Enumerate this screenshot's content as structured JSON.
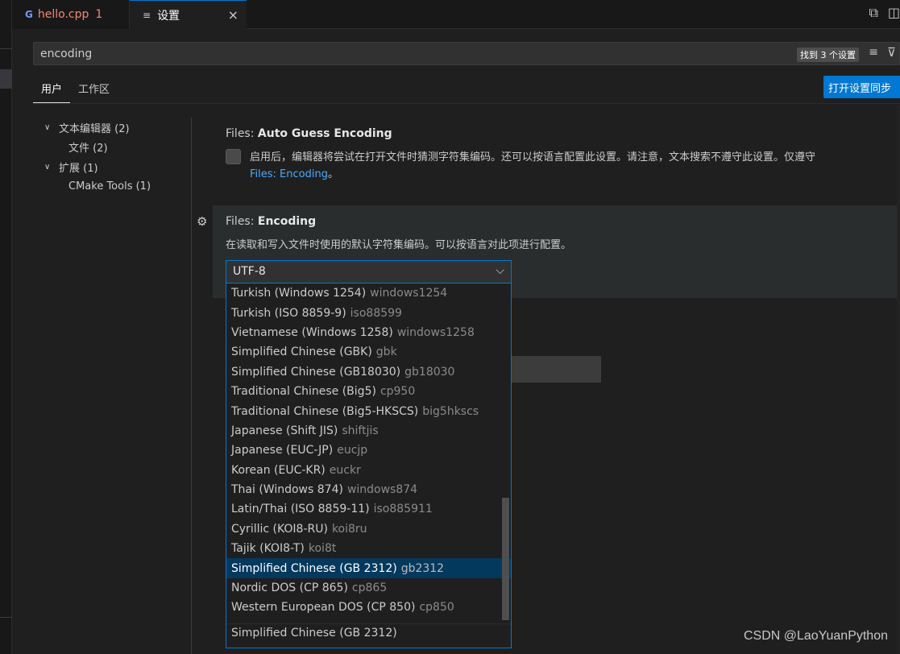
{
  "tabs": {
    "file": {
      "name": "hello.cpp",
      "problems": "1",
      "icon": "G"
    },
    "settings": {
      "icon": "≡",
      "name": "设置",
      "close": "×"
    }
  },
  "top_actions": [
    "⧉",
    "◫"
  ],
  "search": {
    "value": "encoding",
    "result_count": "找到 3 个设置",
    "filter_list_icon": "≡",
    "filter_icon": "⊽"
  },
  "scopes": {
    "user": "用户",
    "workspace": "工作区"
  },
  "sync_button": "打开设置同步",
  "toc": [
    {
      "chev": "∨",
      "label": "文本编辑器 (2)",
      "indent": false
    },
    {
      "chev": "",
      "label": "文件 (2)",
      "indent": true
    },
    {
      "chev": "∨",
      "label": "扩展 (1)",
      "indent": false
    },
    {
      "chev": "",
      "label": "CMake Tools (1)",
      "indent": true
    }
  ],
  "setting_auto_guess": {
    "category": "Files: ",
    "name": "Auto Guess Encoding",
    "description": "启用后，编辑器将尝试在打开文件时猜测字符集编码。还可以按语言配置此设置。请注意，文本搜索不遵守此设置。仅遵守",
    "link": "Files: Encoding",
    "description_end": "。"
  },
  "setting_encoding": {
    "gear": "⚙",
    "category": "Files: ",
    "name": "Encoding",
    "description": "在读取和写入文件时使用的默认字符集编码。可以按语言对此项进行配置。",
    "selected_value": "UTF-8",
    "chevron": "⌵"
  },
  "dropdown": {
    "options": [
      {
        "label": "Turkish (Windows 1254)",
        "code": "windows1254"
      },
      {
        "label": "Turkish (ISO 8859-9)",
        "code": "iso88599"
      },
      {
        "label": "Vietnamese (Windows 1258)",
        "code": "windows1258"
      },
      {
        "label": "Simplified Chinese (GBK)",
        "code": "gbk"
      },
      {
        "label": "Simplified Chinese (GB18030)",
        "code": "gb18030"
      },
      {
        "label": "Traditional Chinese (Big5)",
        "code": "cp950"
      },
      {
        "label": "Traditional Chinese (Big5-HKSCS)",
        "code": "big5hkscs"
      },
      {
        "label": "Japanese (Shift JIS)",
        "code": "shiftjis"
      },
      {
        "label": "Japanese (EUC-JP)",
        "code": "eucjp"
      },
      {
        "label": "Korean (EUC-KR)",
        "code": "euckr"
      },
      {
        "label": "Thai (Windows 874)",
        "code": "windows874"
      },
      {
        "label": "Latin/Thai (ISO 8859-11)",
        "code": "iso885911"
      },
      {
        "label": "Cyrillic (KOI8-RU)",
        "code": "koi8ru"
      },
      {
        "label": "Tajik (KOI8-T)",
        "code": "koi8t"
      },
      {
        "label": "Simplified Chinese (GB 2312)",
        "code": "gb2312",
        "highlighted": true
      },
      {
        "label": "Nordic DOS (CP 865)",
        "code": "cp865"
      },
      {
        "label": "Western European DOS (CP 850)",
        "code": "cp850"
      }
    ],
    "hover_description": "Simplified Chinese (GB 2312)"
  },
  "watermark": "CSDN @LaoYuanPython",
  "colors": {
    "accent": "#0078d4",
    "link": "#4daafc",
    "selection": "#04395e",
    "error": "#f48771"
  }
}
